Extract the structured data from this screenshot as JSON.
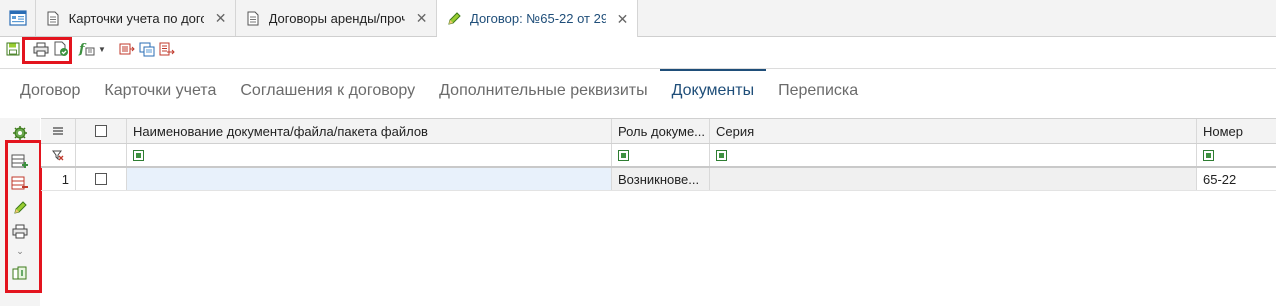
{
  "tabs": [
    {
      "label": "Карточки учета по дого...",
      "close": "✕",
      "icon": "document-icon"
    },
    {
      "label": "Договоры аренды/проч...",
      "close": "✕",
      "icon": "document-icon"
    },
    {
      "label": "Договор: №65-22 от 29....",
      "close": "✕",
      "icon": "pencil-icon",
      "active": true
    }
  ],
  "sections": [
    "Договор",
    "Карточки учета",
    "Соглашения к договору",
    "Дополнительные реквизиты",
    "Документы",
    "Переписка"
  ],
  "active_section": "Документы",
  "grid": {
    "columns": [
      "Наименование документа/файла/пакета файлов",
      "Роль докуме...",
      "Серия",
      "Номер"
    ],
    "rows": [
      {
        "num": "1",
        "name": "",
        "role": "Возникнове...",
        "series": "",
        "number": "65-22"
      }
    ]
  },
  "colors": {
    "accent": "#1f4e79",
    "highlight": "#e3141e",
    "green": "#3d9140"
  }
}
